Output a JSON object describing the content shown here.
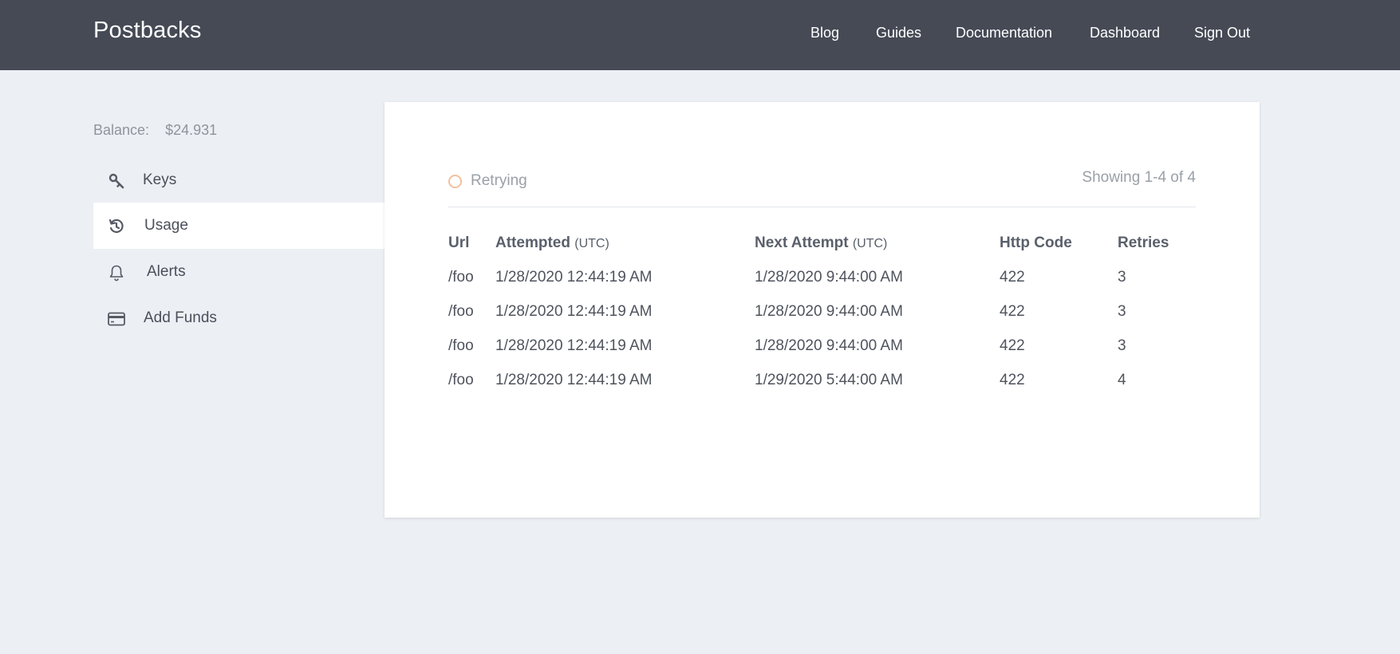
{
  "header": {
    "brand": "Postbacks",
    "nav": [
      "Blog",
      "Guides",
      "Documentation",
      "Dashboard",
      "Sign Out"
    ]
  },
  "sidebar": {
    "balance_label": "Balance:",
    "balance_value": "$24.931",
    "items": [
      {
        "label": "Keys",
        "icon": "key-icon"
      },
      {
        "label": "Usage",
        "icon": "history-icon",
        "active": true
      },
      {
        "label": "Alerts",
        "icon": "bell-icon"
      },
      {
        "label": "Add Funds",
        "icon": "credit-card-icon"
      }
    ]
  },
  "main": {
    "status_label": "Retrying",
    "status_color": "#f5c09d",
    "showing": "Showing 1-4 of 4",
    "table": {
      "columns": [
        {
          "label": "Url",
          "sub": ""
        },
        {
          "label": "Attempted",
          "sub": "(UTC)"
        },
        {
          "label": "Next Attempt",
          "sub": "(UTC)"
        },
        {
          "label": "Http Code",
          "sub": ""
        },
        {
          "label": "Retries",
          "sub": ""
        }
      ],
      "rows": [
        [
          "/foo",
          "1/28/2020 12:44:19 AM",
          "1/28/2020 9:44:00 AM",
          "422",
          "3"
        ],
        [
          "/foo",
          "1/28/2020 12:44:19 AM",
          "1/28/2020 9:44:00 AM",
          "422",
          "3"
        ],
        [
          "/foo",
          "1/28/2020 12:44:19 AM",
          "1/28/2020 9:44:00 AM",
          "422",
          "3"
        ],
        [
          "/foo",
          "1/28/2020 12:44:19 AM",
          "1/29/2020 5:44:00 AM",
          "422",
          "4"
        ]
      ]
    }
  },
  "colors": {
    "topbar": "#454a55",
    "background": "#eceff4",
    "card": "#ffffff"
  }
}
